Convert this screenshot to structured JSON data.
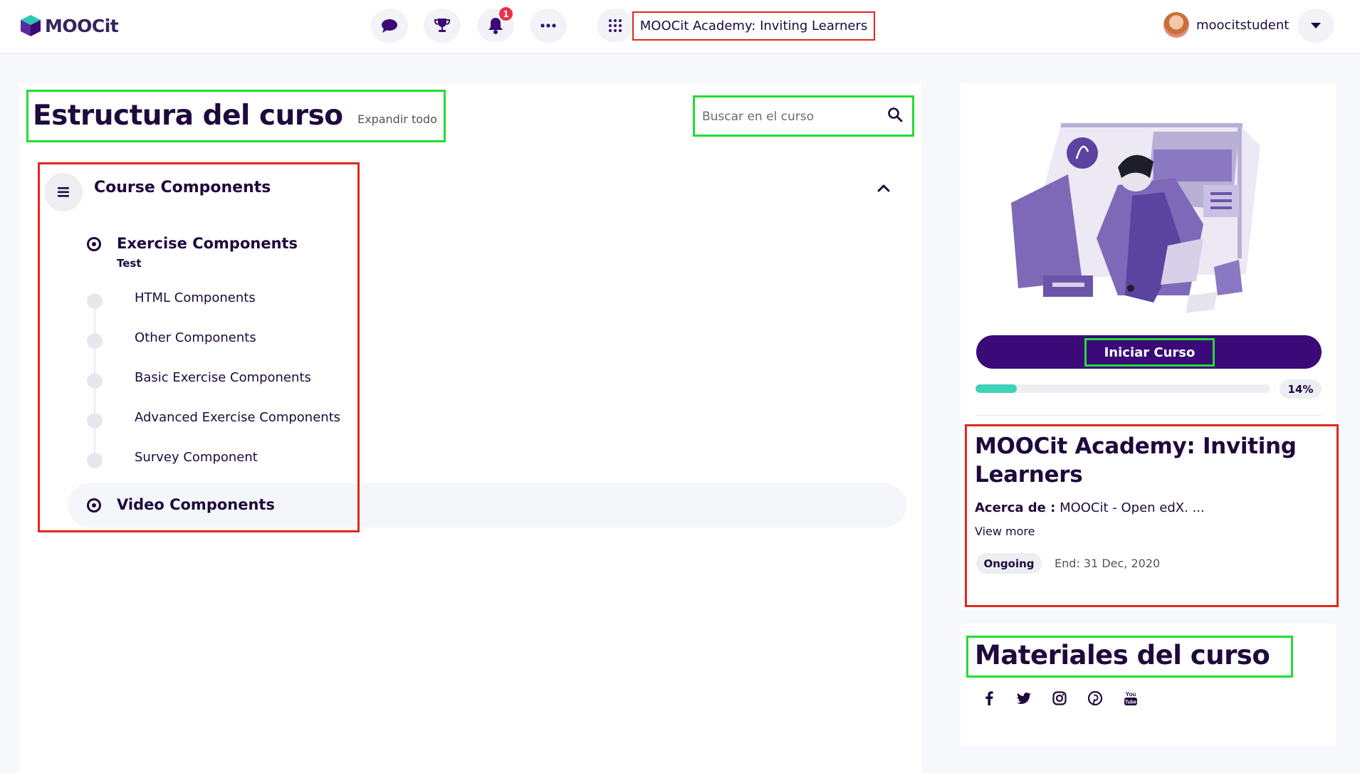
{
  "header": {
    "logo_text": "MOOCit",
    "notification_count": "1",
    "course_title": "MOOCit Academy: Inviting Learners",
    "username": "moocitstudent"
  },
  "outline": {
    "title": "Estructura del curso",
    "expand_all": "Expandir todo",
    "search_placeholder": "Buscar en el curso",
    "section": {
      "title": "Course Components",
      "subsections": [
        {
          "title": "Exercise Components",
          "caption": "Test",
          "units": [
            "HTML Components",
            "Other Components",
            "Basic Exercise Components",
            "Advanced Exercise Components",
            "Survey Component"
          ]
        },
        {
          "title": "Video Components"
        }
      ]
    }
  },
  "sidebar": {
    "start_button": "Iniciar Curso",
    "progress_percent": 14,
    "progress_label": "14%",
    "course_title": "MOOCit Academy: Inviting Learners",
    "about_label": "Acerca de :",
    "about_text": "MOOCit - Open edX. ...",
    "view_more": "View more",
    "status": "Ongoing",
    "end_date": "End: 31 Dec, 2020",
    "materials_title": "Materiales del curso",
    "social_icons": [
      "facebook-icon",
      "twitter-icon",
      "instagram-icon",
      "pinterest-icon",
      "youtube-icon"
    ],
    "youtube_text_top": "You",
    "youtube_text_bottom": "Tube"
  },
  "colors": {
    "brand": "#3b0a78",
    "accent": "#3fd3b9",
    "text": "#1e0a3c",
    "badge": "#e8334a",
    "highlight_green": "#22dd33",
    "highlight_red": "#e3271f"
  }
}
